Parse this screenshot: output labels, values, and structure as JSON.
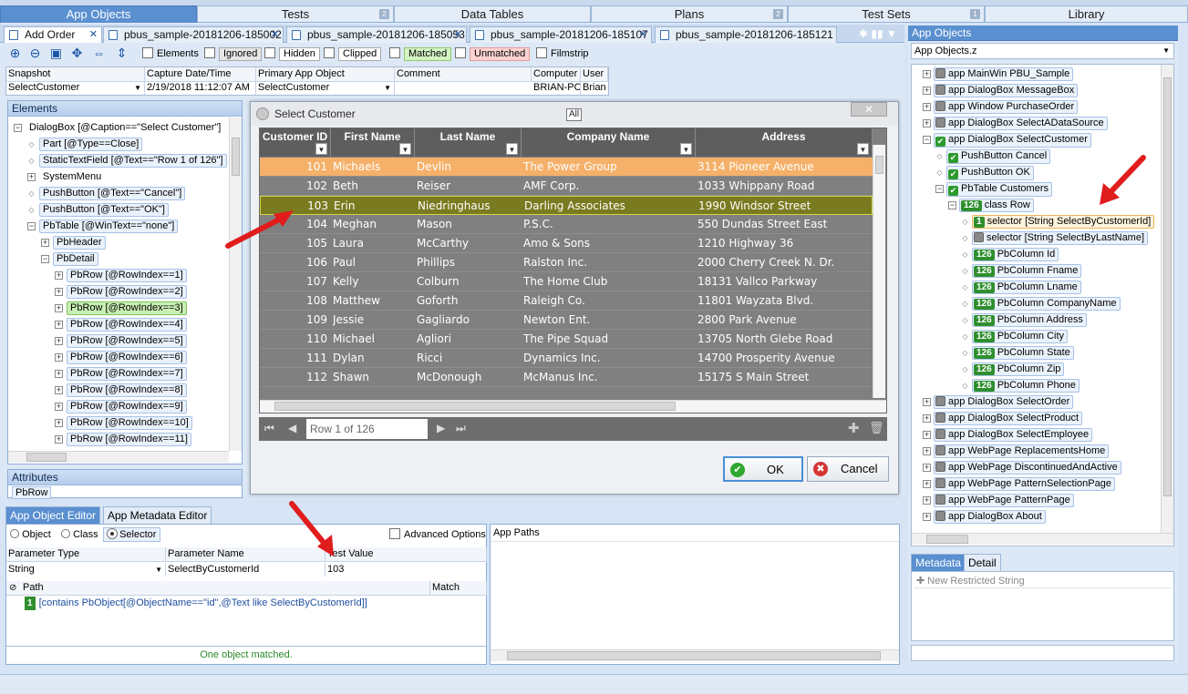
{
  "top_tabs": [
    {
      "label": "App Objects",
      "count": ""
    },
    {
      "label": "Tests",
      "count": "2"
    },
    {
      "label": "Data Tables",
      "count": ""
    },
    {
      "label": "Plans",
      "count": "2"
    },
    {
      "label": "Test Sets",
      "count": "1"
    },
    {
      "label": "Library",
      "count": ""
    }
  ],
  "doc_tabs": [
    "Add Order",
    "pbus_sample-20181206-185002",
    "pbus_sample-20181206-185053",
    "pbus_sample-20181206-185107",
    "pbus_sample-20181206-185121"
  ],
  "toolbar": {
    "elements": "Elements",
    "ignored": "Ignored",
    "hidden": "Hidden",
    "clipped": "Clipped",
    "matched": "Matched",
    "unmatched": "Unmatched",
    "filmstrip": "Filmstrip"
  },
  "snapshot": {
    "headers": [
      "Snapshot",
      "Capture Date/Time",
      "Primary App Object",
      "Comment",
      "Computer",
      "User"
    ],
    "values": [
      "SelectCustomer",
      "2/19/2018 11:12:07 AM",
      "SelectCustomer",
      "",
      "BRIAN-PC",
      "Brian"
    ]
  },
  "elements_panel": {
    "title": "Elements",
    "items": [
      "DialogBox [@Caption==\"Select Customer\"]",
      "Part [@Type==Close]",
      "StaticTextField [@Text==\"Row 1 of 126\"]",
      "SystemMenu",
      "PushButton [@Text==\"Cancel\"]",
      "PushButton [@Text==\"OK\"]",
      "PbTable [@WinText==\"none\"]",
      "PbHeader",
      "PbDetail",
      "PbRow [@RowIndex==1]",
      "PbRow [@RowIndex==2]",
      "PbRow [@RowIndex==3]",
      "PbRow [@RowIndex==4]",
      "PbRow [@RowIndex==5]",
      "PbRow [@RowIndex==6]",
      "PbRow [@RowIndex==7]",
      "PbRow [@RowIndex==8]",
      "PbRow [@RowIndex==9]",
      "PbRow [@RowIndex==10]",
      "PbRow [@RowIndex==11]"
    ]
  },
  "attributes_panel": {
    "title": "Attributes",
    "value": "PbRow"
  },
  "dialog": {
    "title": "Select Customer",
    "all_label": "All",
    "close": "✕",
    "columns": [
      "Customer ID",
      "First Name",
      "Last Name",
      "Company Name",
      "Address"
    ],
    "rows": [
      [
        "101",
        "Michaels",
        "Devlin",
        "The Power Group",
        "3114 Pioneer Avenue"
      ],
      [
        "102",
        "Beth",
        "Reiser",
        "AMF Corp.",
        "1033 Whippany Road"
      ],
      [
        "103",
        "Erin",
        "Niedringhaus",
        "Darling Associates",
        "1990 Windsor Street"
      ],
      [
        "104",
        "Meghan",
        "Mason",
        "P.S.C.",
        "550 Dundas Street East"
      ],
      [
        "105",
        "Laura",
        "McCarthy",
        "Amo & Sons",
        "1210 Highway 36"
      ],
      [
        "106",
        "Paul",
        "Phillips",
        "Ralston Inc.",
        "2000 Cherry Creek N. Dr."
      ],
      [
        "107",
        "Kelly",
        "Colburn",
        "The Home Club",
        "18131 Vallco Parkway"
      ],
      [
        "108",
        "Matthew",
        "Goforth",
        "Raleigh Co.",
        "11801 Wayzata Blvd."
      ],
      [
        "109",
        "Jessie",
        "Gagliardo",
        "Newton Ent.",
        "2800 Park Avenue"
      ],
      [
        "110",
        "Michael",
        "Agliori",
        "The Pipe Squad",
        "13705 North Glebe Road"
      ],
      [
        "111",
        "Dylan",
        "Ricci",
        "Dynamics Inc.",
        "14700 Prosperity Avenue"
      ],
      [
        "112",
        "Shawn",
        "McDonough",
        "McManus Inc.",
        "15175 S Main Street"
      ]
    ],
    "nav_text": "Row 1 of 126",
    "ok": "OK",
    "cancel": "Cancel"
  },
  "editor": {
    "tabs": [
      "App Object Editor",
      "App Metadata Editor"
    ],
    "radios": [
      "Object",
      "Class",
      "Selector"
    ],
    "advanced": "Advanced Options",
    "param_headers": [
      "Parameter Type",
      "Parameter Name",
      "Test Value"
    ],
    "param_values": [
      "String",
      "SelectByCustomerId",
      "103"
    ],
    "path_header": "Path",
    "match_header": "Match",
    "path_num": "1",
    "path_value": "[contains PbObject[@ObjectName==\"id\",@Text like SelectByCustomerId]]",
    "status": "One object matched.",
    "app_paths": "App Paths"
  },
  "right_panel": {
    "title": "App Objects",
    "selector": "App Objects.z",
    "tree": [
      {
        "t": "app MainWin PBU_Sample"
      },
      {
        "t": "app DialogBox MessageBox"
      },
      {
        "t": "app Window PurchaseOrder"
      },
      {
        "t": "app DialogBox SelectADataSource"
      },
      {
        "t": "app DialogBox SelectCustomer"
      },
      {
        "t": "PushButton Cancel"
      },
      {
        "t": "PushButton OK"
      },
      {
        "t": "PbTable Customers"
      },
      {
        "n": "126",
        "t": "class Row"
      },
      {
        "n": "1",
        "t": "selector [String SelectByCustomerId]"
      },
      {
        "t": "selector [String SelectByLastName]"
      },
      {
        "n": "126",
        "t": "PbColumn Id"
      },
      {
        "n": "126",
        "t": "PbColumn Fname"
      },
      {
        "n": "126",
        "t": "PbColumn Lname"
      },
      {
        "n": "126",
        "t": "PbColumn CompanyName"
      },
      {
        "n": "126",
        "t": "PbColumn Address"
      },
      {
        "n": "126",
        "t": "PbColumn City"
      },
      {
        "n": "126",
        "t": "PbColumn State"
      },
      {
        "n": "126",
        "t": "PbColumn Zip"
      },
      {
        "n": "126",
        "t": "PbColumn Phone"
      },
      {
        "t": "app DialogBox SelectOrder"
      },
      {
        "t": "app DialogBox SelectProduct"
      },
      {
        "t": "app DialogBox SelectEmployee"
      },
      {
        "t": "app WebPage ReplacementsHome"
      },
      {
        "t": "app WebPage DiscontinuedAndActive"
      },
      {
        "t": "app WebPage PatternSelectionPage"
      },
      {
        "t": "app WebPage PatternPage"
      },
      {
        "t": "app DialogBox About"
      }
    ],
    "bottom_tabs": [
      "Metadata",
      "Detail"
    ],
    "new_restricted": "New Restricted String"
  }
}
